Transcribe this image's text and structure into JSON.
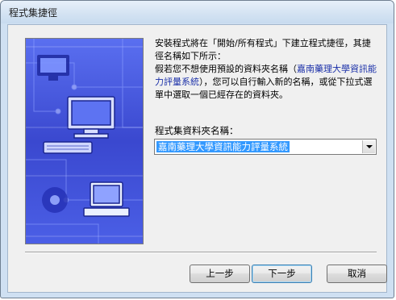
{
  "window": {
    "title": "程式集捷徑"
  },
  "description": {
    "line1": "安裝程式將在「開始/所有程式」下建立程式捷徑，其捷",
    "line2": "徑名稱如下所示：",
    "line3a": "假若您不想使用預設的資料夾名稱（",
    "highlight_a": "嘉南藥理大學資訊能",
    "highlight_b": "力評量系統",
    "line4b": "），您可以自行輸入新的名稱，或從下拉式選",
    "line5": "單中選取一個已經存在的資料夾。"
  },
  "folder": {
    "label": "程式集資料夾名稱：",
    "value": "嘉南藥理大學資訊能力評量系統"
  },
  "buttons": {
    "back": "上一步",
    "next": "下一步",
    "cancel": "取消"
  },
  "colors": {
    "title_bar": "#d3e2f2",
    "client_bg": "#f0f0f0",
    "selection": "#3399ff",
    "banner_blue": "#3f4fd6",
    "highlight_text": "#1a2fa8"
  }
}
